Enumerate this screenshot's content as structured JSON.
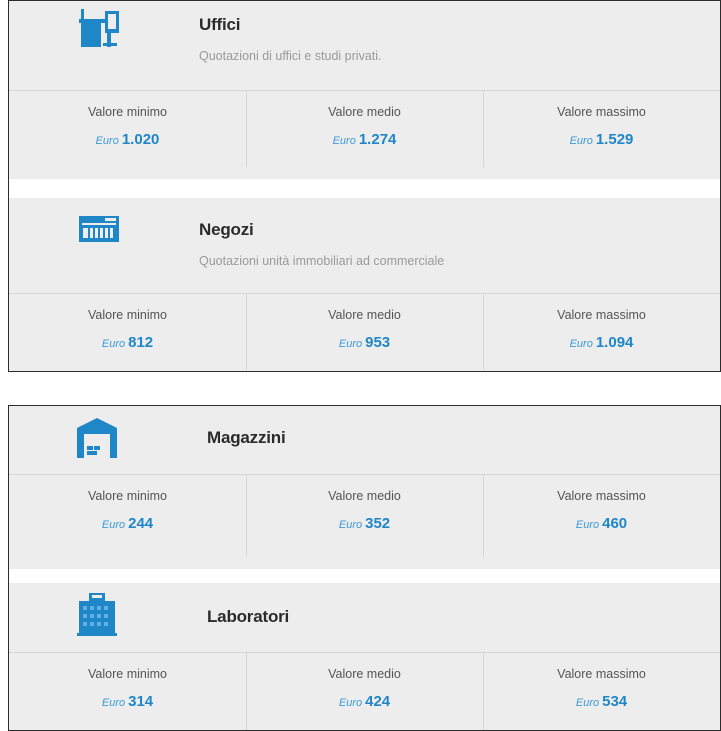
{
  "colors": {
    "accent": "#1f86c8",
    "card_bg": "#ededed",
    "title": "#2b2b2b",
    "subtitle": "#9a9a9a"
  },
  "categories": [
    {
      "title": "Uffici",
      "subtitle": "Quotazioni di uffici e studi privati.",
      "icon": "office-desk-icon",
      "stats": [
        {
          "label": "Valore minimo",
          "currency": "Euro",
          "value": "1.020"
        },
        {
          "label": "Valore medio",
          "currency": "Euro",
          "value": "1.274"
        },
        {
          "label": "Valore massimo",
          "currency": "Euro",
          "value": "1.529"
        }
      ]
    },
    {
      "title": "Negozi",
      "subtitle": "Quotazioni unità immobiliari ad commerciale",
      "icon": "shop-icon",
      "stats": [
        {
          "label": "Valore minimo",
          "currency": "Euro",
          "value": "812"
        },
        {
          "label": "Valore medio",
          "currency": "Euro",
          "value": "953"
        },
        {
          "label": "Valore massimo",
          "currency": "Euro",
          "value": "1.094"
        }
      ]
    },
    {
      "title": "Magazzini",
      "icon": "warehouse-icon",
      "stats": [
        {
          "label": "Valore minimo",
          "currency": "Euro",
          "value": "244"
        },
        {
          "label": "Valore medio",
          "currency": "Euro",
          "value": "352"
        },
        {
          "label": "Valore massimo",
          "currency": "Euro",
          "value": "460"
        }
      ]
    },
    {
      "title": "Laboratori",
      "icon": "laboratory-building-icon",
      "stats": [
        {
          "label": "Valore minimo",
          "currency": "Euro",
          "value": "314"
        },
        {
          "label": "Valore medio",
          "currency": "Euro",
          "value": "424"
        },
        {
          "label": "Valore massimo",
          "currency": "Euro",
          "value": "534"
        }
      ]
    }
  ]
}
